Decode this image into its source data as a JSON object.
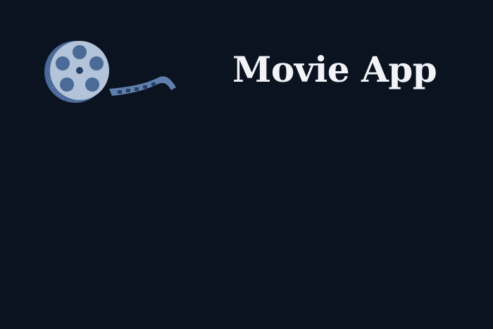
{
  "header": {
    "title": "Movie App",
    "logo_icon": "film-reel-icon"
  },
  "colors": {
    "background": "#0b1220",
    "title_text": "#f1f3f7",
    "reel_face": "#b3c3d9",
    "reel_shadow": "#4a6a97",
    "film_strip": "#5f7fab"
  }
}
